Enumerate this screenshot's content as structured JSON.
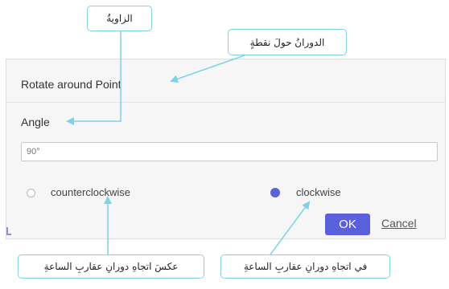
{
  "dialog": {
    "title": "Rotate around Point",
    "angle_label": "Angle",
    "angle_value": "90°",
    "rotation_options": [
      {
        "label": "counterclockwise",
        "selected": false
      },
      {
        "label": "clockwise",
        "selected": true
      }
    ],
    "ok_label": "OK",
    "cancel_label": "Cancel"
  },
  "callouts": {
    "angle": "الزاويةُ",
    "rotate_around_point": "الدورانُ حولَ نقطةٍ",
    "counterclockwise": "عكسَ اتجاهِ دورانِ عقاربِ الساعةِ",
    "clockwise": "في اتجاهِ دورانِ عقاربِ الساعةِ"
  },
  "colors": {
    "accent": "#5a5fdc",
    "callout_border": "#7dd2e6",
    "dialog_bg": "#f6f6f6"
  }
}
